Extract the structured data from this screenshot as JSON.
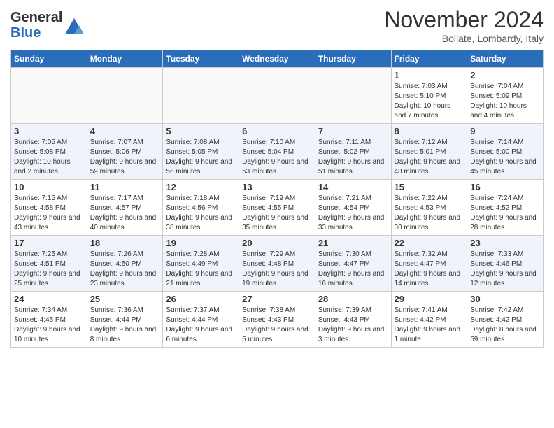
{
  "header": {
    "logo_general": "General",
    "logo_blue": "Blue",
    "month_title": "November 2024",
    "subtitle": "Bollate, Lombardy, Italy"
  },
  "days_of_week": [
    "Sunday",
    "Monday",
    "Tuesday",
    "Wednesday",
    "Thursday",
    "Friday",
    "Saturday"
  ],
  "weeks": [
    [
      {
        "day": "",
        "info": ""
      },
      {
        "day": "",
        "info": ""
      },
      {
        "day": "",
        "info": ""
      },
      {
        "day": "",
        "info": ""
      },
      {
        "day": "",
        "info": ""
      },
      {
        "day": "1",
        "info": "Sunrise: 7:03 AM\nSunset: 5:10 PM\nDaylight: 10 hours and 7 minutes."
      },
      {
        "day": "2",
        "info": "Sunrise: 7:04 AM\nSunset: 5:09 PM\nDaylight: 10 hours and 4 minutes."
      }
    ],
    [
      {
        "day": "3",
        "info": "Sunrise: 7:05 AM\nSunset: 5:08 PM\nDaylight: 10 hours and 2 minutes."
      },
      {
        "day": "4",
        "info": "Sunrise: 7:07 AM\nSunset: 5:06 PM\nDaylight: 9 hours and 59 minutes."
      },
      {
        "day": "5",
        "info": "Sunrise: 7:08 AM\nSunset: 5:05 PM\nDaylight: 9 hours and 56 minutes."
      },
      {
        "day": "6",
        "info": "Sunrise: 7:10 AM\nSunset: 5:04 PM\nDaylight: 9 hours and 53 minutes."
      },
      {
        "day": "7",
        "info": "Sunrise: 7:11 AM\nSunset: 5:02 PM\nDaylight: 9 hours and 51 minutes."
      },
      {
        "day": "8",
        "info": "Sunrise: 7:12 AM\nSunset: 5:01 PM\nDaylight: 9 hours and 48 minutes."
      },
      {
        "day": "9",
        "info": "Sunrise: 7:14 AM\nSunset: 5:00 PM\nDaylight: 9 hours and 45 minutes."
      }
    ],
    [
      {
        "day": "10",
        "info": "Sunrise: 7:15 AM\nSunset: 4:58 PM\nDaylight: 9 hours and 43 minutes."
      },
      {
        "day": "11",
        "info": "Sunrise: 7:17 AM\nSunset: 4:57 PM\nDaylight: 9 hours and 40 minutes."
      },
      {
        "day": "12",
        "info": "Sunrise: 7:18 AM\nSunset: 4:56 PM\nDaylight: 9 hours and 38 minutes."
      },
      {
        "day": "13",
        "info": "Sunrise: 7:19 AM\nSunset: 4:55 PM\nDaylight: 9 hours and 35 minutes."
      },
      {
        "day": "14",
        "info": "Sunrise: 7:21 AM\nSunset: 4:54 PM\nDaylight: 9 hours and 33 minutes."
      },
      {
        "day": "15",
        "info": "Sunrise: 7:22 AM\nSunset: 4:53 PM\nDaylight: 9 hours and 30 minutes."
      },
      {
        "day": "16",
        "info": "Sunrise: 7:24 AM\nSunset: 4:52 PM\nDaylight: 9 hours and 28 minutes."
      }
    ],
    [
      {
        "day": "17",
        "info": "Sunrise: 7:25 AM\nSunset: 4:51 PM\nDaylight: 9 hours and 25 minutes."
      },
      {
        "day": "18",
        "info": "Sunrise: 7:26 AM\nSunset: 4:50 PM\nDaylight: 9 hours and 23 minutes."
      },
      {
        "day": "19",
        "info": "Sunrise: 7:28 AM\nSunset: 4:49 PM\nDaylight: 9 hours and 21 minutes."
      },
      {
        "day": "20",
        "info": "Sunrise: 7:29 AM\nSunset: 4:48 PM\nDaylight: 9 hours and 19 minutes."
      },
      {
        "day": "21",
        "info": "Sunrise: 7:30 AM\nSunset: 4:47 PM\nDaylight: 9 hours and 16 minutes."
      },
      {
        "day": "22",
        "info": "Sunrise: 7:32 AM\nSunset: 4:47 PM\nDaylight: 9 hours and 14 minutes."
      },
      {
        "day": "23",
        "info": "Sunrise: 7:33 AM\nSunset: 4:46 PM\nDaylight: 9 hours and 12 minutes."
      }
    ],
    [
      {
        "day": "24",
        "info": "Sunrise: 7:34 AM\nSunset: 4:45 PM\nDaylight: 9 hours and 10 minutes."
      },
      {
        "day": "25",
        "info": "Sunrise: 7:36 AM\nSunset: 4:44 PM\nDaylight: 9 hours and 8 minutes."
      },
      {
        "day": "26",
        "info": "Sunrise: 7:37 AM\nSunset: 4:44 PM\nDaylight: 9 hours and 6 minutes."
      },
      {
        "day": "27",
        "info": "Sunrise: 7:38 AM\nSunset: 4:43 PM\nDaylight: 9 hours and 5 minutes."
      },
      {
        "day": "28",
        "info": "Sunrise: 7:39 AM\nSunset: 4:43 PM\nDaylight: 9 hours and 3 minutes."
      },
      {
        "day": "29",
        "info": "Sunrise: 7:41 AM\nSunset: 4:42 PM\nDaylight: 9 hours and 1 minute."
      },
      {
        "day": "30",
        "info": "Sunrise: 7:42 AM\nSunset: 4:42 PM\nDaylight: 8 hours and 59 minutes."
      }
    ]
  ]
}
